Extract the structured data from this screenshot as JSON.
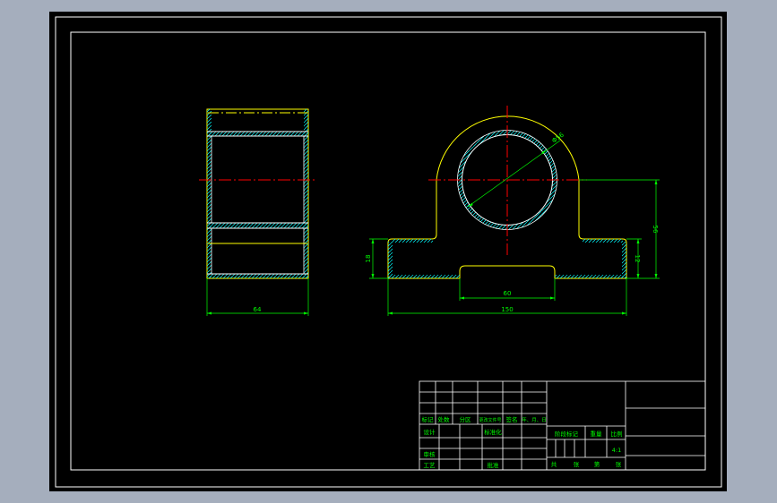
{
  "colors": {
    "window_bg": "#a5aebd",
    "canvas": "#000000",
    "frame": "#ffffff",
    "part_outline": "#ffff00",
    "hatch": "#00ffff",
    "centerline": "#ff0000",
    "dimension": "#00ff00"
  },
  "dimensions": {
    "side_width": "64",
    "bore_diameter": "Φ56",
    "total_height": "56",
    "base_height_left": "18",
    "base_height_right": "12",
    "bottom_slot": "60",
    "base_length": "150"
  },
  "title_block": {
    "row_labels": {
      "mark": "标记",
      "count": "处数",
      "zone": "分区",
      "change_doc": "更改文件号",
      "sign": "签名",
      "date": "年、月、日"
    },
    "design": "设计",
    "standardize": "标准化",
    "review": "审核",
    "process": "工艺",
    "approve": "批准",
    "stage_mark": "阶段标记",
    "weight": "重量",
    "scale": "比例",
    "scale_value": "4:1",
    "total": "共",
    "sheets": "张",
    "page": "第",
    "sheet": "张"
  }
}
